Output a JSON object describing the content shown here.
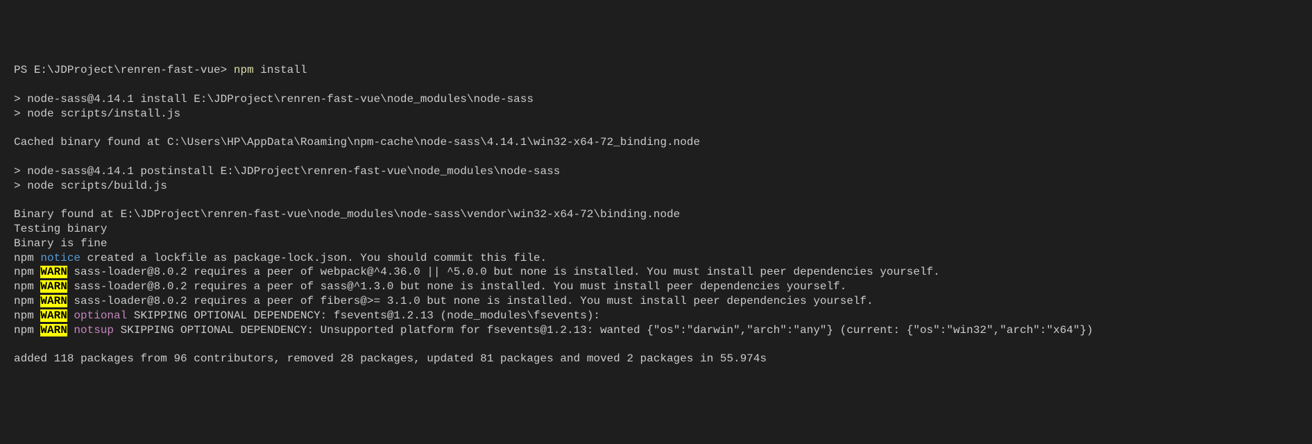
{
  "prompt": {
    "ps": "PS ",
    "path": "E:\\JDProject\\renren-fast-vue> ",
    "cmd_npm": "npm",
    "cmd_install": " install"
  },
  "lines": {
    "empty": "",
    "nodesass_install": "> node-sass@4.14.1 install E:\\JDProject\\renren-fast-vue\\node_modules\\node-sass",
    "node_install_script": "> node scripts/install.js",
    "cached_binary": "Cached binary found at C:\\Users\\HP\\AppData\\Roaming\\npm-cache\\node-sass\\4.14.1\\win32-x64-72_binding.node",
    "nodesass_postinstall": "> node-sass@4.14.1 postinstall E:\\JDProject\\renren-fast-vue\\node_modules\\node-sass",
    "node_build_script": "> node scripts/build.js",
    "binary_found": "Binary found at E:\\JDProject\\renren-fast-vue\\node_modules\\node-sass\\vendor\\win32-x64-72\\binding.node",
    "testing_binary": "Testing binary",
    "binary_fine": "Binary is fine",
    "npm_prefix": "npm ",
    "notice_label": "notice",
    "notice_text": " created a lockfile as package-lock.json. You should commit this file.",
    "warn_label": "WARN",
    "warn1_text": " sass-loader@8.0.2 requires a peer of webpack@^4.36.0 || ^5.0.0 but none is installed. You must install peer dependencies yourself.",
    "warn2_text": " sass-loader@8.0.2 requires a peer of sass@^1.3.0 but none is installed. You must install peer dependencies yourself.",
    "warn3_text": " sass-loader@8.0.2 requires a peer of fibers@>= 3.1.0 but none is installed. You must install peer dependencies yourself.",
    "optional_label": " optional",
    "warn4_text": " SKIPPING OPTIONAL DEPENDENCY: fsevents@1.2.13 (node_modules\\fsevents):",
    "notsup_label": " notsup",
    "warn5_text": " SKIPPING OPTIONAL DEPENDENCY: Unsupported platform for fsevents@1.2.13: wanted {\"os\":\"darwin\",\"arch\":\"any\"} (current: {\"os\":\"win32\",\"arch\":\"x64\"})",
    "summary": "added 118 packages from 96 contributors, removed 28 packages, updated 81 packages and moved 2 packages in 55.974s"
  }
}
